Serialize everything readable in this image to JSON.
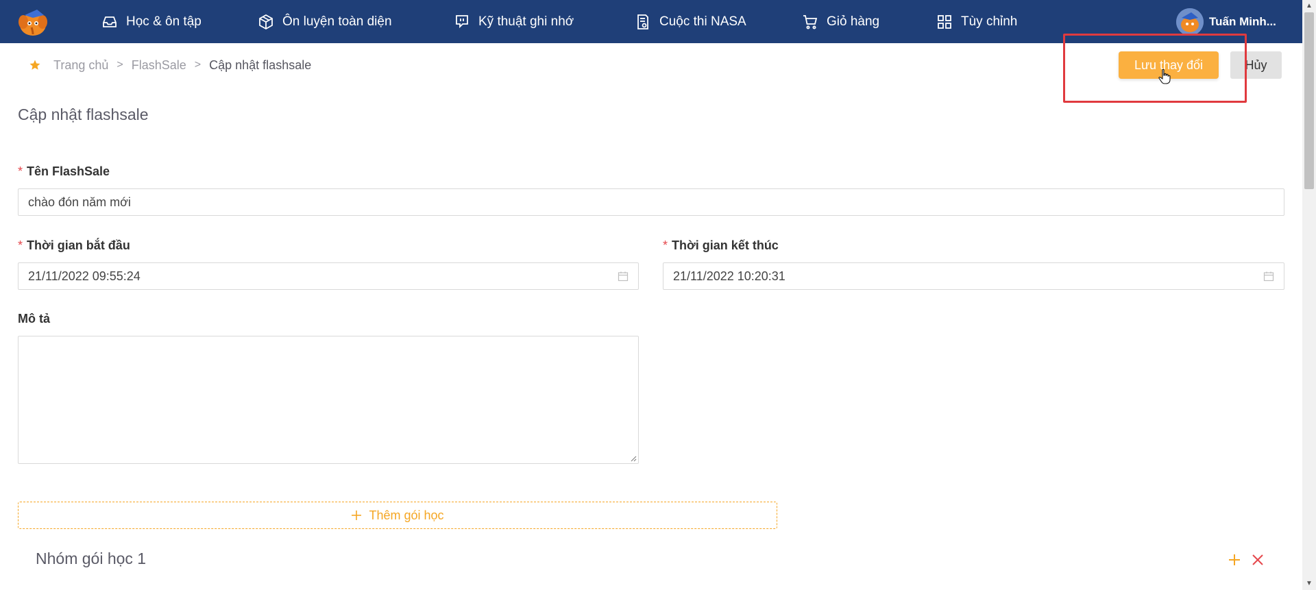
{
  "nav": {
    "items": [
      {
        "label": "Học & ôn tập",
        "icon": "inbox-icon"
      },
      {
        "label": "Ôn luyện toàn diện",
        "icon": "box-icon"
      },
      {
        "label": "Kỹ thuật ghi nhớ",
        "icon": "chat-icon"
      },
      {
        "label": "Cuộc thi NASA",
        "icon": "document-icon"
      },
      {
        "label": "Giỏ hàng",
        "icon": "cart-icon"
      },
      {
        "label": "Tùy chỉnh",
        "icon": "grid-icon"
      }
    ],
    "user_name": "Tuấn Minh..."
  },
  "breadcrumb": {
    "home": "Trang chủ",
    "section": "FlashSale",
    "current": "Cập nhật flashsale",
    "separator": ">"
  },
  "actions": {
    "save_label": "Lưu thay đổi",
    "cancel_label": "Hủy"
  },
  "page": {
    "title": "Cập nhật flashsale"
  },
  "form": {
    "required_mark": "*",
    "name_label": "Tên FlashSale",
    "name_value": "chào đón năm mới",
    "start_label": "Thời gian bắt đầu",
    "start_value": "21/11/2022 09:55:24",
    "end_label": "Thời gian kết thúc",
    "end_value": "21/11/2022 10:20:31",
    "desc_label": "Mô tả",
    "desc_value": ""
  },
  "packages": {
    "add_label": "Thêm gói học",
    "group_title": "Nhóm gói học 1"
  },
  "colors": {
    "nav_bg": "#1f3f78",
    "accent": "#fbb040",
    "highlight": "#e03a3e"
  }
}
